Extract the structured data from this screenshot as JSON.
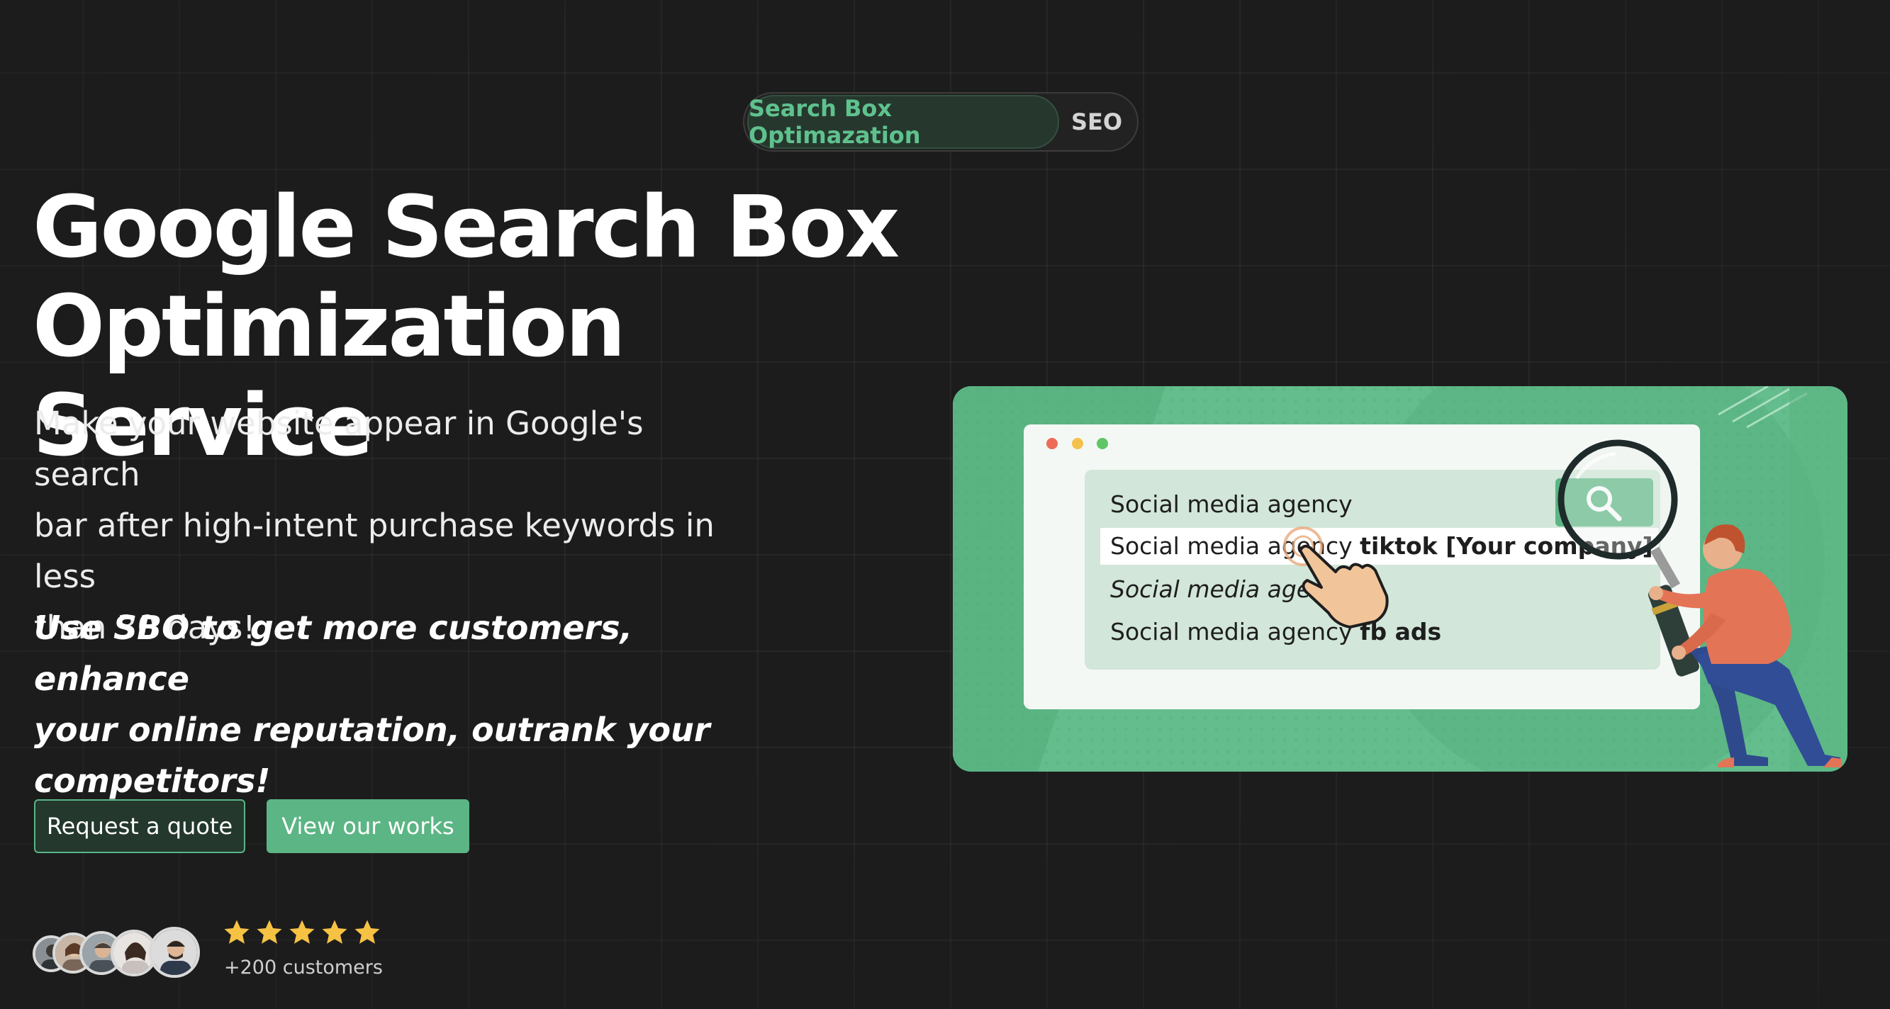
{
  "colors": {
    "background": "#1c1c1c",
    "accent_green": "#5bb584",
    "pill_active_text": "#5fc28e",
    "star": "#f6c244"
  },
  "toggle": {
    "active_label": "Search Box Optimazation",
    "inactive_label": "SEO"
  },
  "hero": {
    "title_line1": "Google Search Box",
    "title_line2": "Optimization Service",
    "subtitle_line1": "Make your website appear in Google's search",
    "subtitle_line2": "bar after high-intent purchase keywords in less",
    "subtitle_line3": "than 30 days!",
    "tagline_line1": "Use SBO to get more customers, enhance",
    "tagline_line2": "your online reputation, outrank your",
    "tagline_line3": "competitors!"
  },
  "buttons": {
    "quote_label": "Request a quote",
    "works_label": "View our works"
  },
  "social_proof": {
    "rating_stars": 5,
    "rating_max": 5,
    "customers_label": "+200 customers",
    "avatar_count": 5
  },
  "illustration": {
    "suggestions": [
      {
        "prefix": "Social media agency",
        "suffix": ""
      },
      {
        "prefix": "Social media agency",
        "suffix": "tiktok [Your company]"
      },
      {
        "prefix": "Social media agency",
        "suffix": ""
      },
      {
        "prefix": "Social media agency",
        "suffix": "fb ads"
      }
    ],
    "icons": [
      "search-icon",
      "magnifying-glass-icon",
      "hand-cursor-icon"
    ]
  }
}
